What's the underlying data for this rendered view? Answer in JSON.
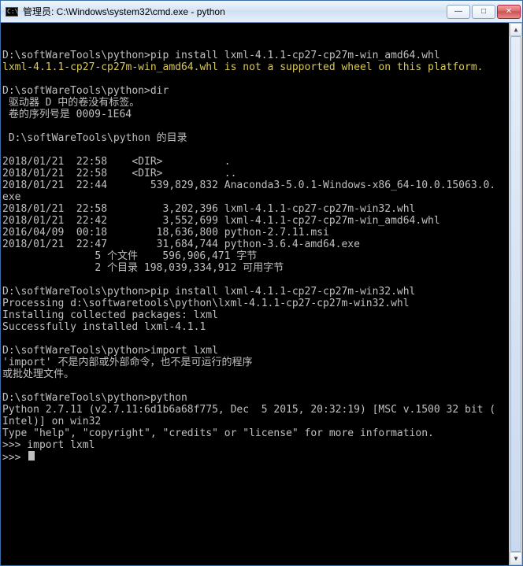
{
  "titlebar": {
    "icon_label": "C:\\",
    "title": "管理员: C:\\Windows\\system32\\cmd.exe - python",
    "min_glyph": "—",
    "max_glyph": "□",
    "close_glyph": "✕"
  },
  "scrollbar": {
    "up": "▲",
    "down": "▼"
  },
  "term": {
    "blank": "",
    "l01": "D:\\softWareTools\\python>pip install lxml-4.1.1-cp27-cp27m-win_amd64.whl",
    "l02": "lxml-4.1.1-cp27-cp27m-win_amd64.whl is not a supported wheel on this platform.",
    "l03": "D:\\softWareTools\\python>dir",
    "l04": " 驱动器 D 中的卷没有标签。",
    "l05": " 卷的序列号是 0009-1E64",
    "l06": " D:\\softWareTools\\python 的目录",
    "l07": "2018/01/21  22:58    <DIR>          .",
    "l08": "2018/01/21  22:58    <DIR>          ..",
    "l09": "2018/01/21  22:44       539,829,832 Anaconda3-5.0.1-Windows-x86_64-10.0.15063.0.",
    "l09b": "exe",
    "l10": "2018/01/21  22:58         3,202,396 lxml-4.1.1-cp27-cp27m-win32.whl",
    "l11": "2018/01/21  22:42         3,552,699 lxml-4.1.1-cp27-cp27m-win_amd64.whl",
    "l12": "2016/04/09  00:18        18,636,800 python-2.7.11.msi",
    "l13": "2018/01/21  22:47        31,684,744 python-3.6.4-amd64.exe",
    "l14": "               5 个文件    596,906,471 字节",
    "l15": "               2 个目录 198,039,334,912 可用字节",
    "l16": "D:\\softWareTools\\python>pip install lxml-4.1.1-cp27-cp27m-win32.whl",
    "l17": "Processing d:\\softwaretools\\python\\lxml-4.1.1-cp27-cp27m-win32.whl",
    "l18": "Installing collected packages: lxml",
    "l19": "Successfully installed lxml-4.1.1",
    "l20": "D:\\softWareTools\\python>import lxml",
    "l21": "'import' 不是内部或外部命令，也不是可运行的程序",
    "l22": "或批处理文件。",
    "l23": "D:\\softWareTools\\python>python",
    "l24": "Python 2.7.11 (v2.7.11:6d1b6a68f775, Dec  5 2015, 20:32:19) [MSC v.1500 32 bit (",
    "l25": "Intel)] on win32",
    "l26": "Type \"help\", \"copyright\", \"credits\" or \"license\" for more information.",
    "l27": ">>> import lxml",
    "l28": ">>> "
  }
}
